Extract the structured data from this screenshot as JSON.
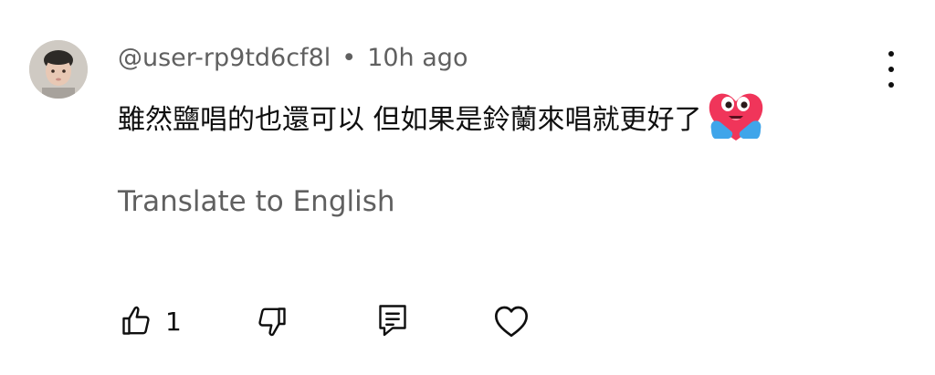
{
  "comment": {
    "author": "@user-rp9td6cf8l",
    "separator": "•",
    "timestamp": "10h ago",
    "text": "雖然鹽唱的也還可以 但如果是鈴蘭來唱就更好了",
    "emoji": "hugging-heart-emoji",
    "translate_label": "Translate to English",
    "more_icon": "more-vertical-icon"
  },
  "actions": {
    "like_icon": "thumbs-up-icon",
    "like_count": "1",
    "dislike_icon": "thumbs-down-icon",
    "reply_icon": "reply-comment-icon",
    "heart_icon": "heart-outline-icon"
  },
  "colors": {
    "primary_text": "#0f0f0f",
    "secondary_text": "#606060",
    "emoji_heart": "#f0355a",
    "emoji_hands": "#3fa5ea"
  }
}
